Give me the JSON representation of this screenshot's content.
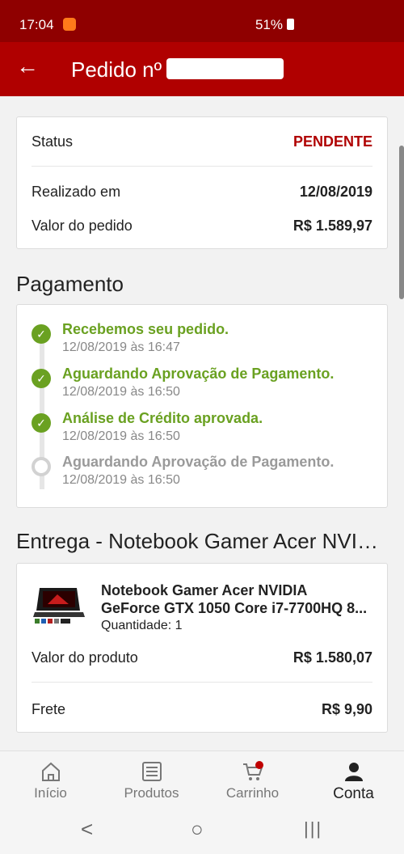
{
  "status_bar": {
    "time": "17:04",
    "battery": "51%",
    "signal": "📶"
  },
  "header": {
    "back_icon": "arrow-left-icon",
    "title": "Pedido nº"
  },
  "summary": {
    "status_label": "Status",
    "status_value": "PENDENTE",
    "status_color": "#b00000",
    "date_label": "Realizado em",
    "date_value": "12/08/2019",
    "total_label": "Valor do pedido",
    "total_value": "R$ 1.589,97"
  },
  "payment": {
    "title": "Pagamento",
    "steps": [
      {
        "label": "Recebemos seu pedido.",
        "date": "12/08/2019 às 16:47",
        "done": true
      },
      {
        "label": "Aguardando Aprovação de Pagamento.",
        "date": "12/08/2019 às 16:50",
        "done": true
      },
      {
        "label": "Análise de Crédito aprovada.",
        "date": "12/08/2019 às 16:50",
        "done": true
      },
      {
        "label": "Aguardando Aprovação de Pagamento.",
        "date": "12/08/2019 às 16:50",
        "done": false
      }
    ]
  },
  "delivery": {
    "title": "Entrega - Notebook Gamer Acer NVIDI...",
    "product_line1": "Notebook Gamer Acer NVIDIA",
    "product_line2": "GeForce GTX 1050 Core i7-7700HQ 8...",
    "quantity": "Quantidade: 1",
    "value_label": "Valor do produto",
    "value": "R$ 1.580,07",
    "shipping_label": "Frete",
    "shipping_value": "R$ 9,90"
  },
  "nav": {
    "items": [
      {
        "label": "Início",
        "icon": "home-icon"
      },
      {
        "label": "Produtos",
        "icon": "list-icon"
      },
      {
        "label": "Carrinho",
        "icon": "cart-icon"
      },
      {
        "label": "Conta",
        "icon": "user-icon"
      }
    ],
    "active": "Conta"
  },
  "system_nav": {
    "back": "<",
    "home": "○",
    "recents": "|||"
  }
}
